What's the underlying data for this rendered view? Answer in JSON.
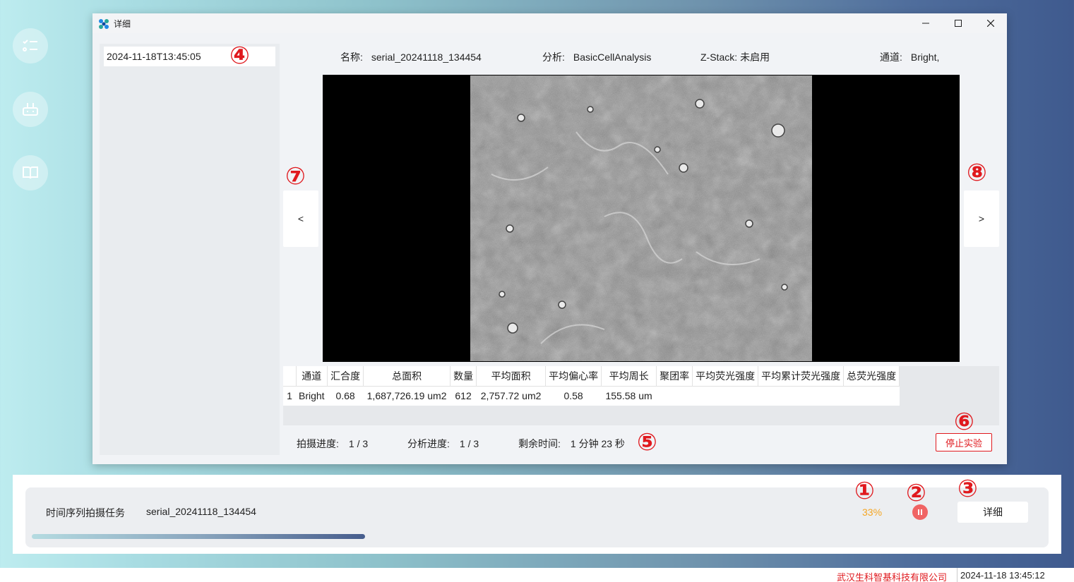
{
  "window": {
    "title": "详细"
  },
  "sidebar": {
    "items": [
      {
        "label": "2024-11-18T13:45:05"
      }
    ]
  },
  "meta": {
    "name_label": "名称:",
    "name_value": "serial_20241118_134454",
    "analysis_label": "分析:",
    "analysis_value": "BasicCellAnalysis",
    "zstack_label": "Z-Stack:",
    "zstack_value": "未启用",
    "channel_label": "通道:",
    "channel_value": "Bright,"
  },
  "nav": {
    "prev_label": "<",
    "next_label": ">"
  },
  "results_table": {
    "headers": [
      "",
      "通道",
      "汇合度",
      "总面积",
      "数量",
      "平均面积",
      "平均偏心率",
      "平均周长",
      "聚团率",
      "平均荧光强度",
      "平均累计荧光强度",
      "总荧光强度"
    ],
    "rows": [
      [
        "1",
        "Bright",
        "0.68",
        "1,687,726.19 um2",
        "612",
        "2,757.72 um2",
        "0.58",
        "155.58 um",
        "",
        "",
        "",
        ""
      ]
    ]
  },
  "progress": {
    "capture_label": "拍摄进度:",
    "capture_value": "1 / 3",
    "analysis_label": "分析进度:",
    "analysis_value": "1 / 3",
    "remaining_label": "剩余时间:",
    "remaining_value": "1 分钟 23 秒"
  },
  "stop_button": {
    "label": "停止实验"
  },
  "task": {
    "type_label": "时间序列拍摄任务",
    "name": "serial_20241118_134454",
    "percent_text": "33%",
    "progress_fraction": 0.33,
    "detail_label": "详细"
  },
  "footer": {
    "company": "武汉生科智基科技有限公司",
    "datetime": "2024-11-18 13:45:12"
  },
  "annotations": {
    "a1": "①",
    "a2": "②",
    "a3": "③",
    "a4": "④",
    "a5": "⑤",
    "a6": "⑥",
    "a7": "⑦",
    "a8": "⑧"
  },
  "colors": {
    "accent_red": "#e0191e",
    "percent_orange": "#f5a623",
    "pause_red": "#f06464"
  },
  "icons": {
    "rail": [
      "tasks-icon",
      "device-icon",
      "book-icon"
    ]
  }
}
